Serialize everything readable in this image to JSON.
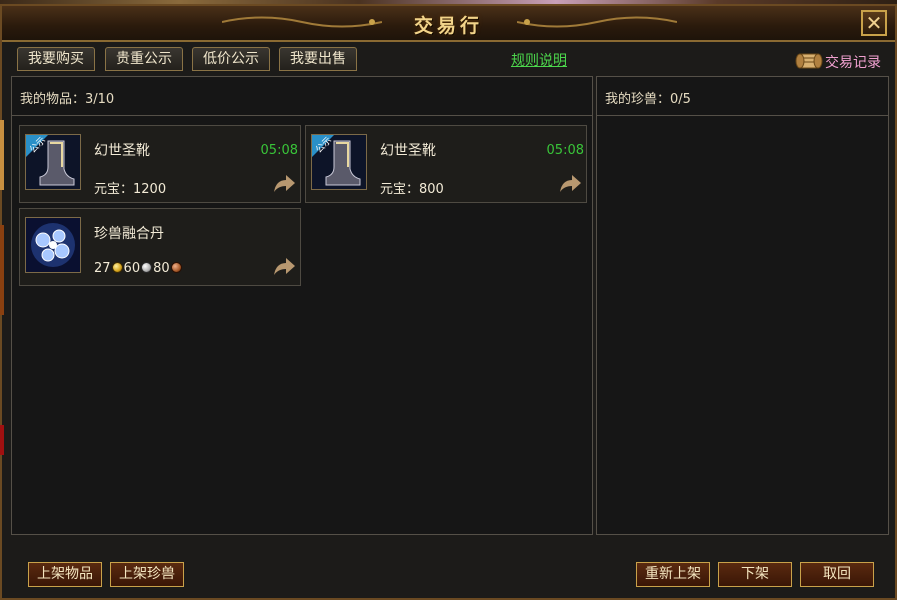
{
  "window": {
    "title": "交易行"
  },
  "tabs": [
    {
      "label": "我要购买"
    },
    {
      "label": "贵重公示"
    },
    {
      "label": "低价公示"
    },
    {
      "label": "我要出售"
    }
  ],
  "rules_link": "规则说明",
  "trade_record": {
    "label": "交易记录",
    "icon": "scroll-icon"
  },
  "my_items": {
    "title": "我的物品：3/10",
    "items": [
      {
        "name": "幻世圣靴",
        "price": "元宝：1200",
        "time": "05:08",
        "icon": "boots-icon",
        "badge": "公示"
      },
      {
        "name": "幻世圣靴",
        "price": "元宝：800",
        "time": "05:08",
        "icon": "boots-icon",
        "badge": "公示"
      },
      {
        "name": "珍兽融合丹",
        "gold": "27",
        "silver": "60",
        "copper": "80",
        "icon": "bubbles-icon"
      }
    ]
  },
  "my_pets": {
    "title": "我的珍兽：0/5"
  },
  "bottom_buttons": {
    "list_item": "上架物品",
    "list_pet": "上架珍兽",
    "relist": "重新上架",
    "delist": "下架",
    "retrieve": "取回"
  },
  "colors": {
    "timer": "#39c439",
    "link": "#4cd64c",
    "record": "#f0a0d0",
    "title": "#f2d48a"
  }
}
